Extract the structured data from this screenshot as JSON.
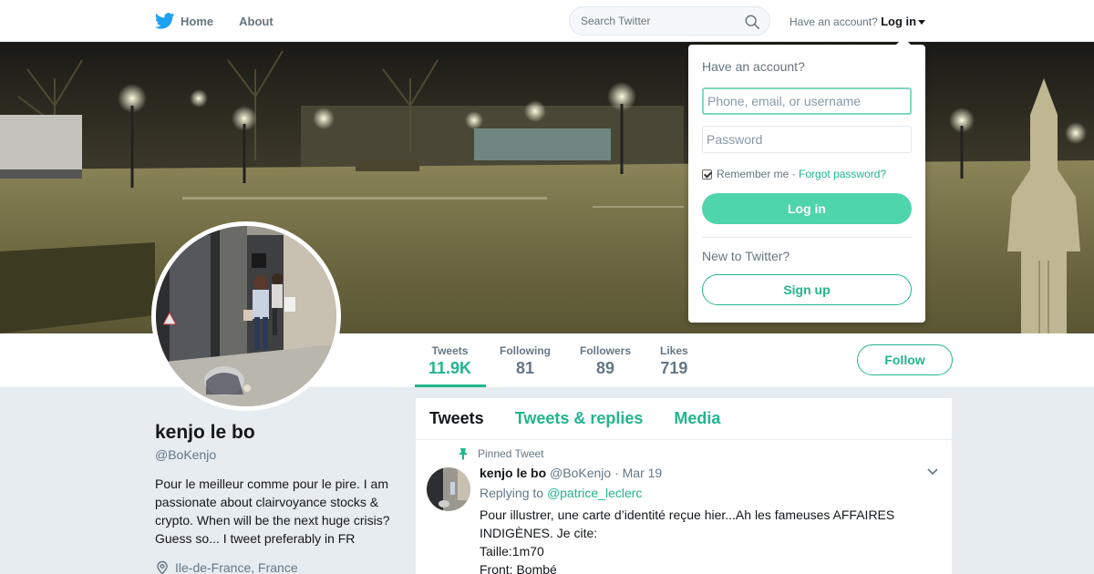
{
  "nav": {
    "home_label": "Home",
    "about_label": "About",
    "search_placeholder": "Search Twitter",
    "have_account_text": "Have an account?",
    "login_label": "Log in"
  },
  "profile": {
    "name": "kenjo le bo",
    "handle": "@BoKenjo",
    "bio": "Pour le meilleur comme pour le pire. I am passionate about clairvoyance stocks & crypto. When will be the next huge crisis? Guess so... I tweet preferably in FR",
    "location": "Ile-de-France, France",
    "follow_label": "Follow"
  },
  "stats": [
    {
      "label": "Tweets",
      "value": "11.9K"
    },
    {
      "label": "Following",
      "value": "81"
    },
    {
      "label": "Followers",
      "value": "89"
    },
    {
      "label": "Likes",
      "value": "719"
    }
  ],
  "timeline": {
    "tabs": [
      "Tweets",
      "Tweets & replies",
      "Media"
    ],
    "tweet": {
      "pinned_label": "Pinned Tweet",
      "name": "kenjo le bo",
      "handle": "@BoKenjo",
      "date": "· Mar 19",
      "replying_prefix": "Replying to",
      "replying_to": "@patrice_leclerc",
      "text": "Pour illustrer, une carte d’identité reçue hier...Ah les fameuses AFFAIRES INDIGÈNES. Je cite:\nTaille:1m70\nFront: Bombé"
    }
  },
  "login_dropdown": {
    "title": "Have an account?",
    "username_placeholder": "Phone, email, or username",
    "password_placeholder": "Password",
    "remember_label": "Remember me",
    "separator": "·",
    "forgot_label": "Forgot password?",
    "login_button": "Log in",
    "new_to_label": "New to Twitter?",
    "signup_button": "Sign up"
  },
  "colors": {
    "accent": "#22b58e",
    "login_button": "#4fd5ab",
    "twitter_blue": "#1da1f2"
  }
}
